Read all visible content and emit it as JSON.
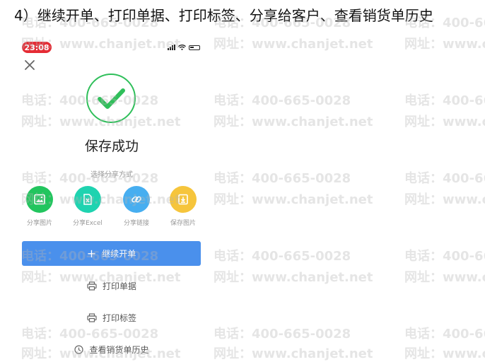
{
  "caption": "4）继续开单、打印单据、打印标签、分享给客户、查看销货单历史",
  "watermark": {
    "phone": "电话：400-665-0028",
    "site": "网址：www.chanjet.net"
  },
  "status_bar": {
    "time": "23:08",
    "time_badge_color": "#e52c35"
  },
  "success": {
    "title": "保存成功",
    "check_color": "#2fbf5a"
  },
  "share": {
    "label": "选择分享方式",
    "options": [
      {
        "label": "分享图片",
        "icon": "image-icon",
        "color": "#22c55e"
      },
      {
        "label": "分享Excel",
        "icon": "excel-file-icon",
        "color": "#1fd3b0"
      },
      {
        "label": "分享链接",
        "icon": "link-icon",
        "color": "#47aef0"
      },
      {
        "label": "保存图片",
        "icon": "download-image-icon",
        "color": "#f6c53c"
      }
    ]
  },
  "actions": {
    "continue_label": "继续开单",
    "print_document_label": "打印单据",
    "print_label_label": "打印标签",
    "history_label": "查看销货单历史"
  }
}
